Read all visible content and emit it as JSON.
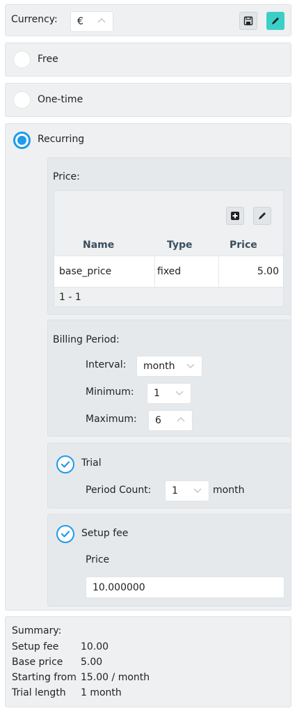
{
  "currency": {
    "label": "Currency:",
    "value": "€",
    "save_icon": "save-icon",
    "edit_icon": "pencil-icon"
  },
  "pricing_options": {
    "free": {
      "label": "Free",
      "selected": false
    },
    "onetime": {
      "label": "One-time",
      "selected": false
    },
    "recurring": {
      "label": "Recurring",
      "selected": true
    }
  },
  "price": {
    "label": "Price:",
    "table": {
      "headers": [
        "Name",
        "Type",
        "Price"
      ],
      "rows": [
        {
          "name": "base_price",
          "type": "fixed",
          "price": "5.00"
        }
      ],
      "pagination": "1 - 1"
    }
  },
  "billing": {
    "label": "Billing Period:",
    "interval_label": "Interval:",
    "interval_value": "month",
    "minimum_label": "Minimum:",
    "minimum_value": "1",
    "maximum_label": "Maximum:",
    "maximum_value": "6"
  },
  "trial": {
    "label": "Trial",
    "checked": true,
    "period_count_label": "Period Count:",
    "period_count_value": "1",
    "unit": "month"
  },
  "setup_fee": {
    "label": "Setup fee",
    "checked": true,
    "price_label": "Price",
    "price_value": "10.000000"
  },
  "summary": {
    "title": "Summary:",
    "rows": [
      {
        "label": "Setup fee",
        "value": "10.00"
      },
      {
        "label": "Base price",
        "value": "5.00"
      },
      {
        "label": "Starting from",
        "value": "15.00 / month"
      },
      {
        "label": "Trial length",
        "value": "1 month"
      }
    ]
  },
  "colors": {
    "accent": "#1e9bea",
    "teal_button": "#3ccfc8",
    "panel_bg": "#eef0f1"
  }
}
